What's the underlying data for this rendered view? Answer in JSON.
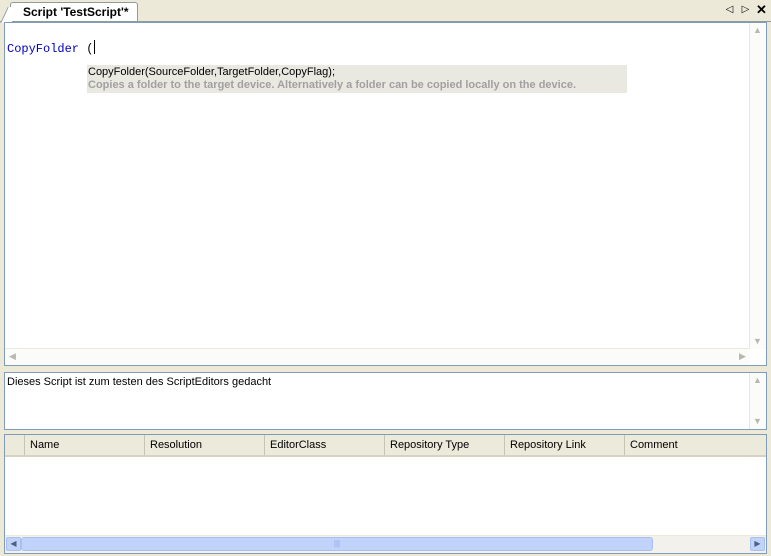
{
  "tab": {
    "title": "Script 'TestScript'*",
    "prev_icon": "◁",
    "next_icon": "▷",
    "close_icon": "✕"
  },
  "editor": {
    "code_text": "CopyFolder",
    "code_paren": " (",
    "tooltip": {
      "signature": "CopyFolder(SourceFolder,TargetFolder,CopyFlag);",
      "description": "Copies a folder to the target device. Alternatively a folder can be copied locally on the device."
    }
  },
  "description": {
    "text": "Dieses Script ist zum testen des ScriptEditors gedacht"
  },
  "list": {
    "columns": [
      "Name",
      "Resolution",
      "EditorClass",
      "Repository Type",
      "Repository Link",
      "Comment"
    ],
    "rows": []
  },
  "scroll": {
    "up": "▲",
    "down": "▼",
    "left": "◀",
    "right": "▶",
    "grip": "|||"
  }
}
